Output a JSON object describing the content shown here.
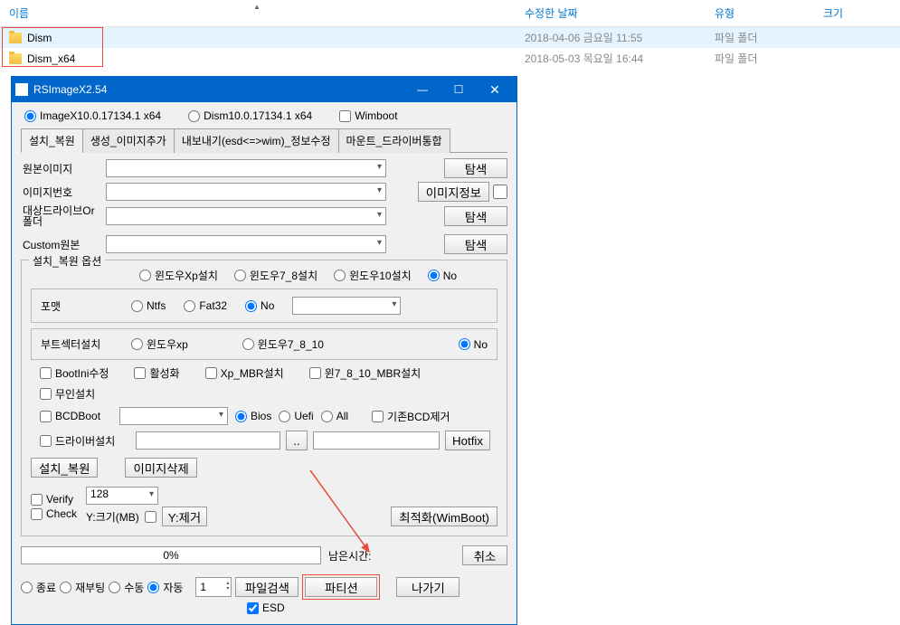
{
  "explorer": {
    "headers": {
      "name": "이름",
      "date": "수정한 날짜",
      "type": "유형",
      "size": "크기"
    },
    "rows": [
      {
        "name": "Dism",
        "date": "2018-04-06 금요일 11:55",
        "type": "파일 폴더"
      },
      {
        "name": "Dism_x64",
        "date": "2018-05-03 목요일 16:44",
        "type": "파일 폴더"
      }
    ]
  },
  "dialog": {
    "title": "RSImageX2.54",
    "top": {
      "opt1": "ImageX10.0.17134.1 x64",
      "opt2": "Dism10.0.17134.1 x64",
      "wimboot": "Wimboot"
    },
    "tabs": {
      "t1": "설치_복원",
      "t2": "생성_이미지추가",
      "t3": "내보내기(esd<=>wim)_정보수정",
      "t4": "마운트_드라이버통합"
    },
    "labels": {
      "source_image": "원본이미지",
      "image_number": "이미지번호",
      "target_drive": "대상드라이브Or 폴더",
      "custom_source": "Custom원본"
    },
    "buttons": {
      "browse": "탐색",
      "image_info": "이미지정보"
    },
    "group": {
      "title": "설치_복원 옵션",
      "os": {
        "xp": "윈도우Xp설치",
        "w78": "윈도우7_8설치",
        "w10": "윈도우10설치",
        "no": "No"
      },
      "format": {
        "label": "포맷",
        "ntfs": "Ntfs",
        "fat32": "Fat32",
        "no": "No"
      },
      "boot": {
        "label": "부트섹터설치",
        "xp": "윈도우xp",
        "w7810": "윈도우7_8_10",
        "no": "No"
      },
      "checks": {
        "bootini": "BootIni수정",
        "activate": "활성화",
        "xpmbr": "Xp_MBR설치",
        "win78mbr": "윈7_8_10_MBR설치",
        "unattend": "무인설치",
        "bcdboot": "BCDBoot",
        "driver": "드라이버설치"
      },
      "bcd": {
        "bios": "Bios",
        "uefi": "Uefi",
        "all": "All",
        "removebcd": "기존BCD제거"
      },
      "hotfix": "Hotfix",
      "install_restore": "설치_복원",
      "delete_image": "이미지삭제",
      "verify": "Verify",
      "check": "Check",
      "num128": "128",
      "ysize": "Y:크기(MB)",
      "yremove": "Y:제거",
      "optimize": "최적화(WimBoot)"
    },
    "progress": {
      "pct": "0%",
      "remaining": "남은시간:",
      "cancel": "취소"
    },
    "bottom": {
      "exit_opt": "종료",
      "reboot": "재부팅",
      "manual": "수동",
      "auto": "자동",
      "spinval": "1",
      "filesearch": "파일검색",
      "partition": "파티션",
      "exit": "나가기",
      "esd": "ESD"
    }
  }
}
